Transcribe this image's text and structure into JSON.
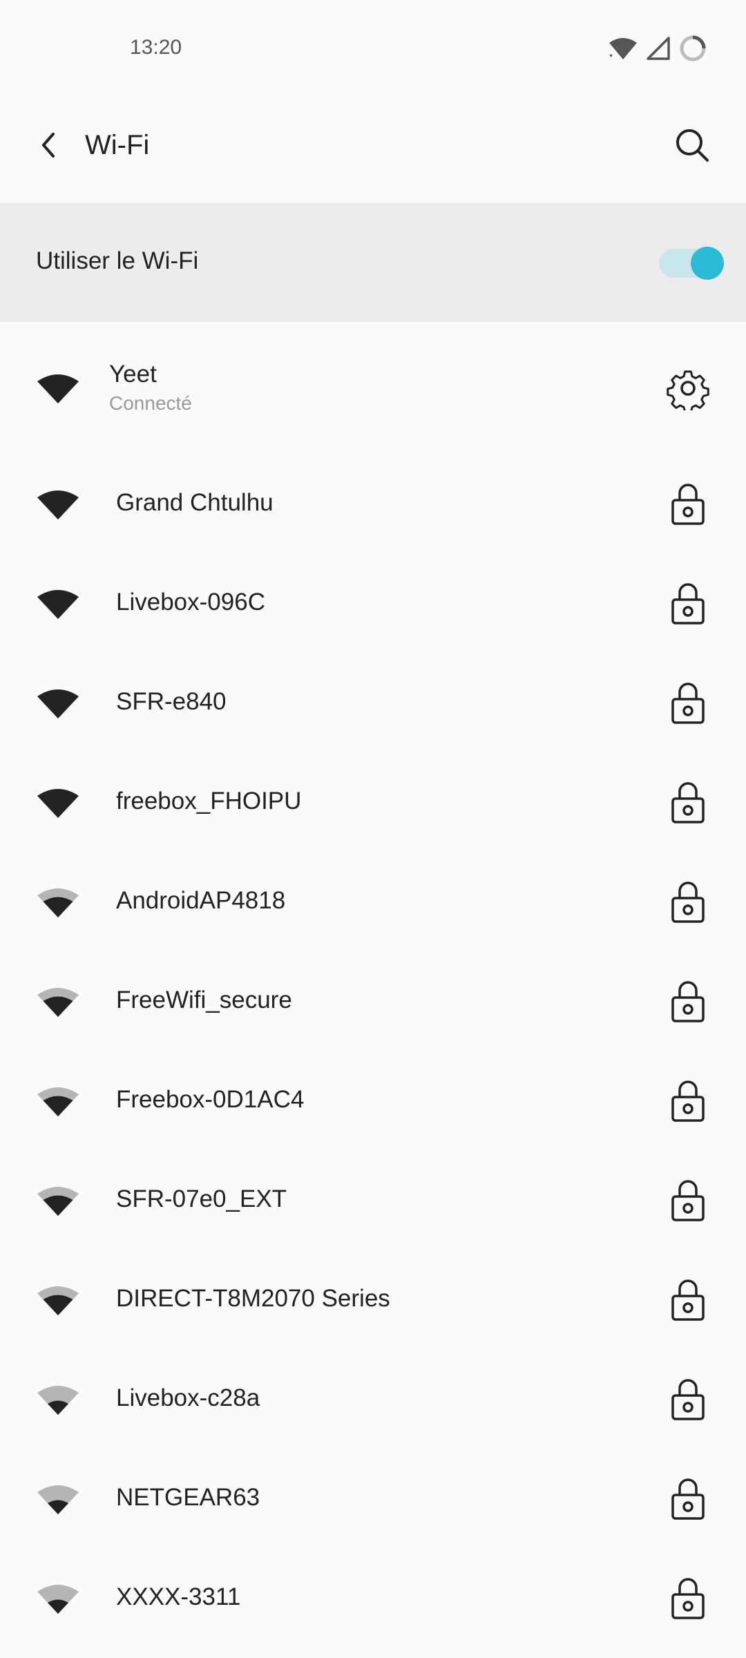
{
  "status_bar": {
    "time": "13:20",
    "icons": [
      "wifi-signal-icon",
      "cell-signal-icon",
      "battery-saver-icon"
    ]
  },
  "app_bar": {
    "title": "Wi-Fi",
    "back_icon": "back-arrow-icon",
    "search_icon": "search-icon"
  },
  "wifi_toggle": {
    "label": "Utiliser le Wi-Fi",
    "enabled": true,
    "accent_color": "#2abbd8"
  },
  "connected_network": {
    "name": "Yeet",
    "status": "Connecté",
    "signal": "full",
    "settings_icon": "gear-icon"
  },
  "networks": [
    {
      "name": "Grand Chtulhu",
      "signal": "full",
      "secured": true
    },
    {
      "name": "Livebox-096C",
      "signal": "full",
      "secured": true
    },
    {
      "name": "SFR-e840",
      "signal": "full",
      "secured": true
    },
    {
      "name": "freebox_FHOIPU",
      "signal": "full",
      "secured": true
    },
    {
      "name": "AndroidAP4818",
      "signal": "medium",
      "secured": true
    },
    {
      "name": "FreeWifi_secure",
      "signal": "medium",
      "secured": true
    },
    {
      "name": "Freebox-0D1AC4",
      "signal": "medium",
      "secured": true
    },
    {
      "name": "SFR-07e0_EXT",
      "signal": "medium",
      "secured": true
    },
    {
      "name": "DIRECT-T8M2070 Series",
      "signal": "medium",
      "secured": true
    },
    {
      "name": "Livebox-c28a",
      "signal": "low",
      "secured": true
    },
    {
      "name": "NETGEAR63",
      "signal": "low",
      "secured": true
    },
    {
      "name": "XXXX-3311",
      "signal": "low",
      "secured": true
    }
  ]
}
